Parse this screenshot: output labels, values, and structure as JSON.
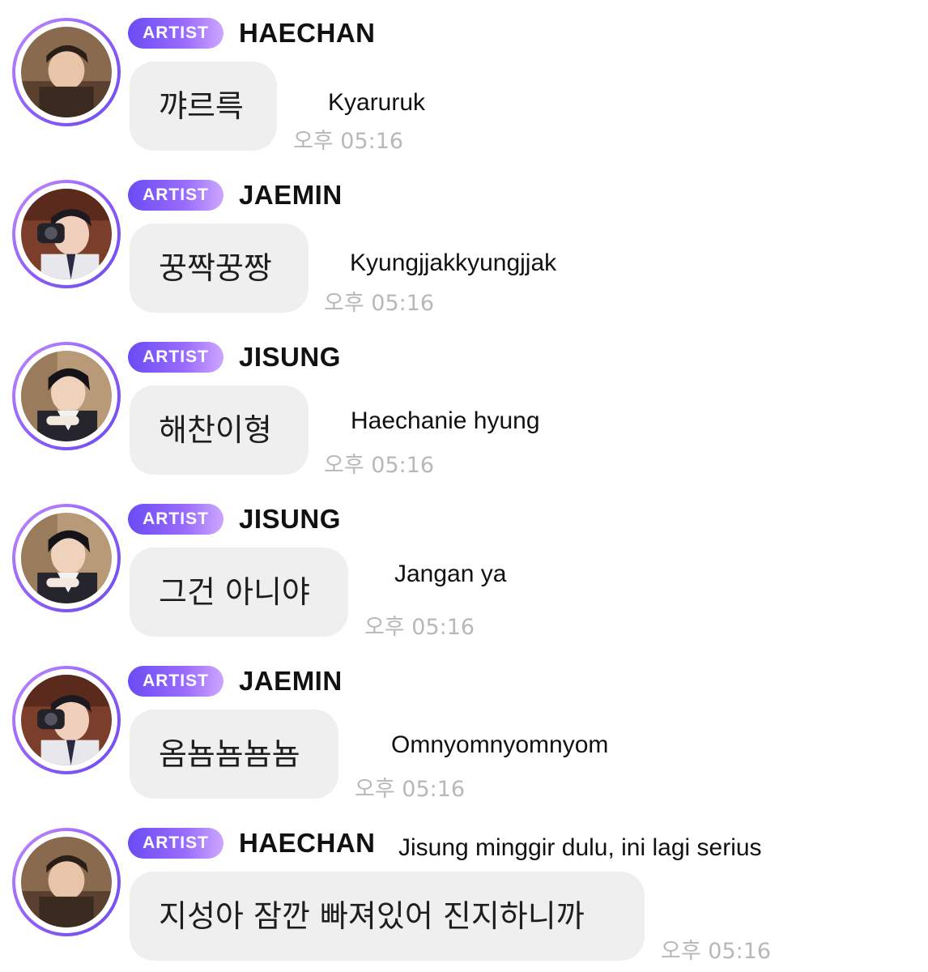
{
  "messages": [
    {
      "badge": "ARTIST",
      "name": "HAECHAN",
      "text": "꺄르륵",
      "time": "오후 05:16",
      "translation": "Kyaruruk"
    },
    {
      "badge": "ARTIST",
      "name": "JAEMIN",
      "text": "꿍짝꿍짱",
      "time": "오후 05:16",
      "translation": "Kyungjjakkyungjjak"
    },
    {
      "badge": "ARTIST",
      "name": "JISUNG",
      "text": "해찬이형",
      "time": "오후 05:16",
      "translation": "Haechanie hyung"
    },
    {
      "badge": "ARTIST",
      "name": "JISUNG",
      "text": "그건 아니야",
      "time": "오후 05:16",
      "translation": "Jangan ya"
    },
    {
      "badge": "ARTIST",
      "name": "JAEMIN",
      "text": "옴뇸뇸뇸뇸",
      "time": "오후 05:16",
      "translation": "Omnyomnyomnyom"
    },
    {
      "badge": "ARTIST",
      "name": "HAECHAN",
      "text": "지성아 잠깐 빠져있어 진지하니까",
      "time": "오후 05:16",
      "translation": "Jisung minggir dulu, ini lagi serius"
    }
  ]
}
